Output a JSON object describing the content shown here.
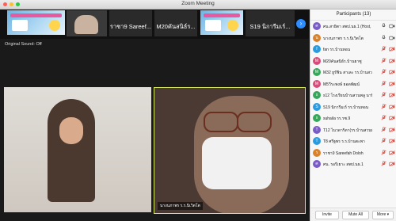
{
  "window": {
    "title": "Zoom Meeting"
  },
  "thumbnails": [
    {
      "name": "ราชา9 Sareef..."
    },
    {
      "name": "M20คันสนิธ์ร..."
    },
    {
      "name": "S19 นิการีมเร์..."
    }
  ],
  "original_sound": "Original Sound: Off",
  "video_main": {
    "label": "นางนภาพร  ร.ร.นิเวิตโต"
  },
  "participants": {
    "header": "Participants (13)",
    "items": [
      {
        "initial": "ศ",
        "name": "ศน.สายิตา สพป.นธ.1 (Host, me)",
        "color": "#7a5cc6",
        "mic": "on",
        "cam": "on"
      },
      {
        "initial": "น",
        "name": "นางนภาพร  ร.ร.นิเวิตโต",
        "color": "#d9822b",
        "mic": "on",
        "cam": "on"
      },
      {
        "initial": "f",
        "name": "fan รร.บ้านทอน",
        "color": "#2b9be0",
        "mic": "off",
        "cam": "off"
      },
      {
        "initial": "M",
        "name": "M20คันสนิธ์ร.บ้านยาซู",
        "color": "#d94b7a",
        "mic": "off",
        "cam": "off"
      },
      {
        "initial": "M",
        "name": "M32 ยูรัฟิน สาเละ รร.บ้านสวนพลู",
        "color": "#37a85b",
        "mic": "off",
        "cam": "off"
      },
      {
        "initial": "M",
        "name": "M5วีระพงษ์ ยอดพัฒน์",
        "color": "#d94b7a",
        "mic": "off",
        "cam": "off"
      },
      {
        "initial": "s",
        "name": "s12 โรงเรียนบ้านสวนพลู นาบิยะห์",
        "color": "#37a85b",
        "mic": "off",
        "cam": "off"
      },
      {
        "initial": "S",
        "name": "S19 นิการีมเร์ รร.บ้านทอน",
        "color": "#2b9be0",
        "mic": "off",
        "cam": "off"
      },
      {
        "initial": "s",
        "name": "suhaila  รร.รซ.9",
        "color": "#37a85b",
        "mic": "off",
        "cam": "off"
      },
      {
        "initial": "T",
        "name": "T12 ไนวดาริดา(รร.บ้านสวนพลู)",
        "color": "#7a5cc6",
        "mic": "off",
        "cam": "off"
      },
      {
        "initial": "T",
        "name": "T8 ศรีฐพร ร.ร.บ้านตะพา",
        "color": "#2b9be0",
        "mic": "off",
        "cam": "off"
      },
      {
        "initial": "ร",
        "name": "ราชา9 Sareefah Doloh",
        "color": "#d9822b",
        "mic": "off",
        "cam": "off"
      },
      {
        "initial": "ศ",
        "name": "ศน. รอรีเยาะ สพป.นธ.1",
        "color": "#7a5cc6",
        "mic": "off",
        "cam": "off"
      }
    ],
    "footer": {
      "invite": "Invite",
      "mute_all": "Mute All",
      "more": "More"
    }
  }
}
